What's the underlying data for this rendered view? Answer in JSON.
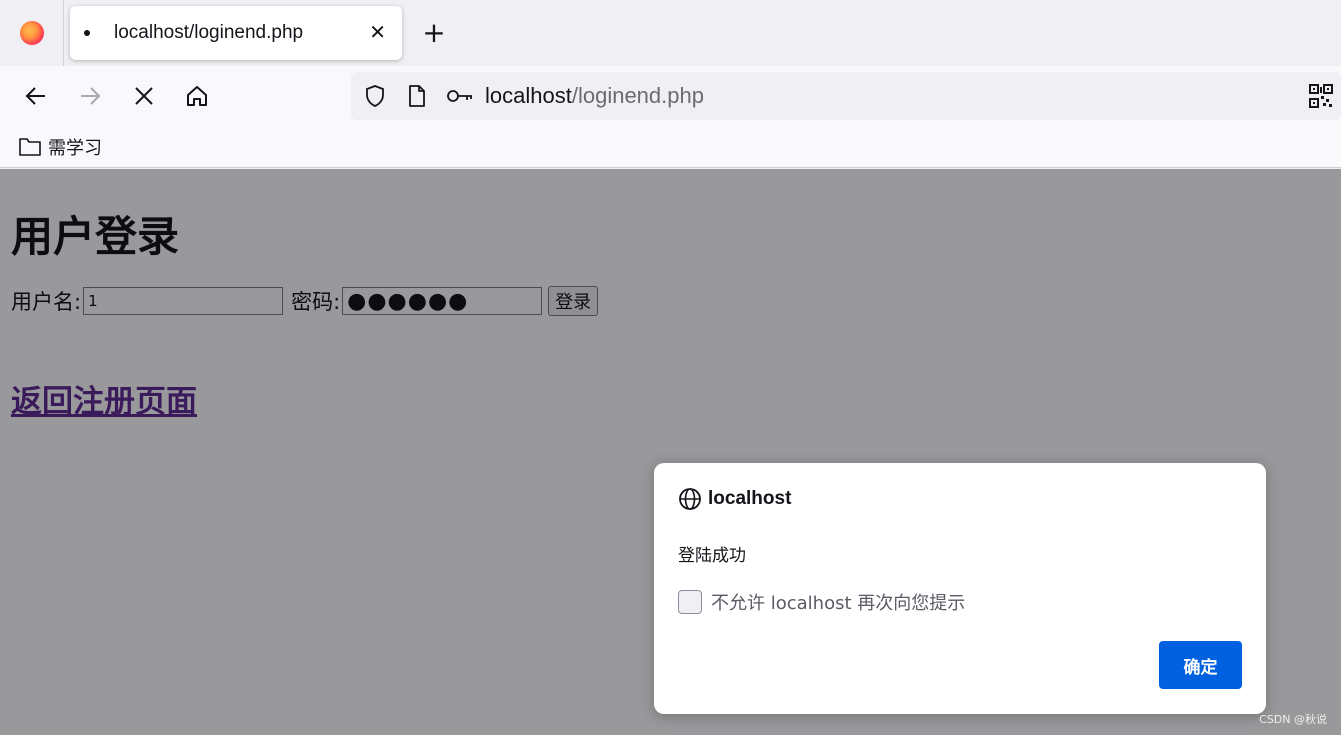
{
  "browser": {
    "tab": {
      "title": "localhost/loginend.php"
    },
    "url": {
      "host": "localhost",
      "path": "/loginend.php"
    },
    "bookmarks": [
      {
        "label": "需学习"
      }
    ]
  },
  "page": {
    "heading": "用户登录",
    "form": {
      "username_label": "用户名:",
      "username_value": "1",
      "password_label": "密码:",
      "password_mask": "●●●●●●",
      "submit_label": "登录"
    },
    "back_link": "返回注册页面"
  },
  "dialog": {
    "host": "localhost",
    "message": "登陆成功",
    "checkbox_label": "不允许 localhost 再次向您提示",
    "ok_label": "确定"
  },
  "watermark": "CSDN @秋说"
}
